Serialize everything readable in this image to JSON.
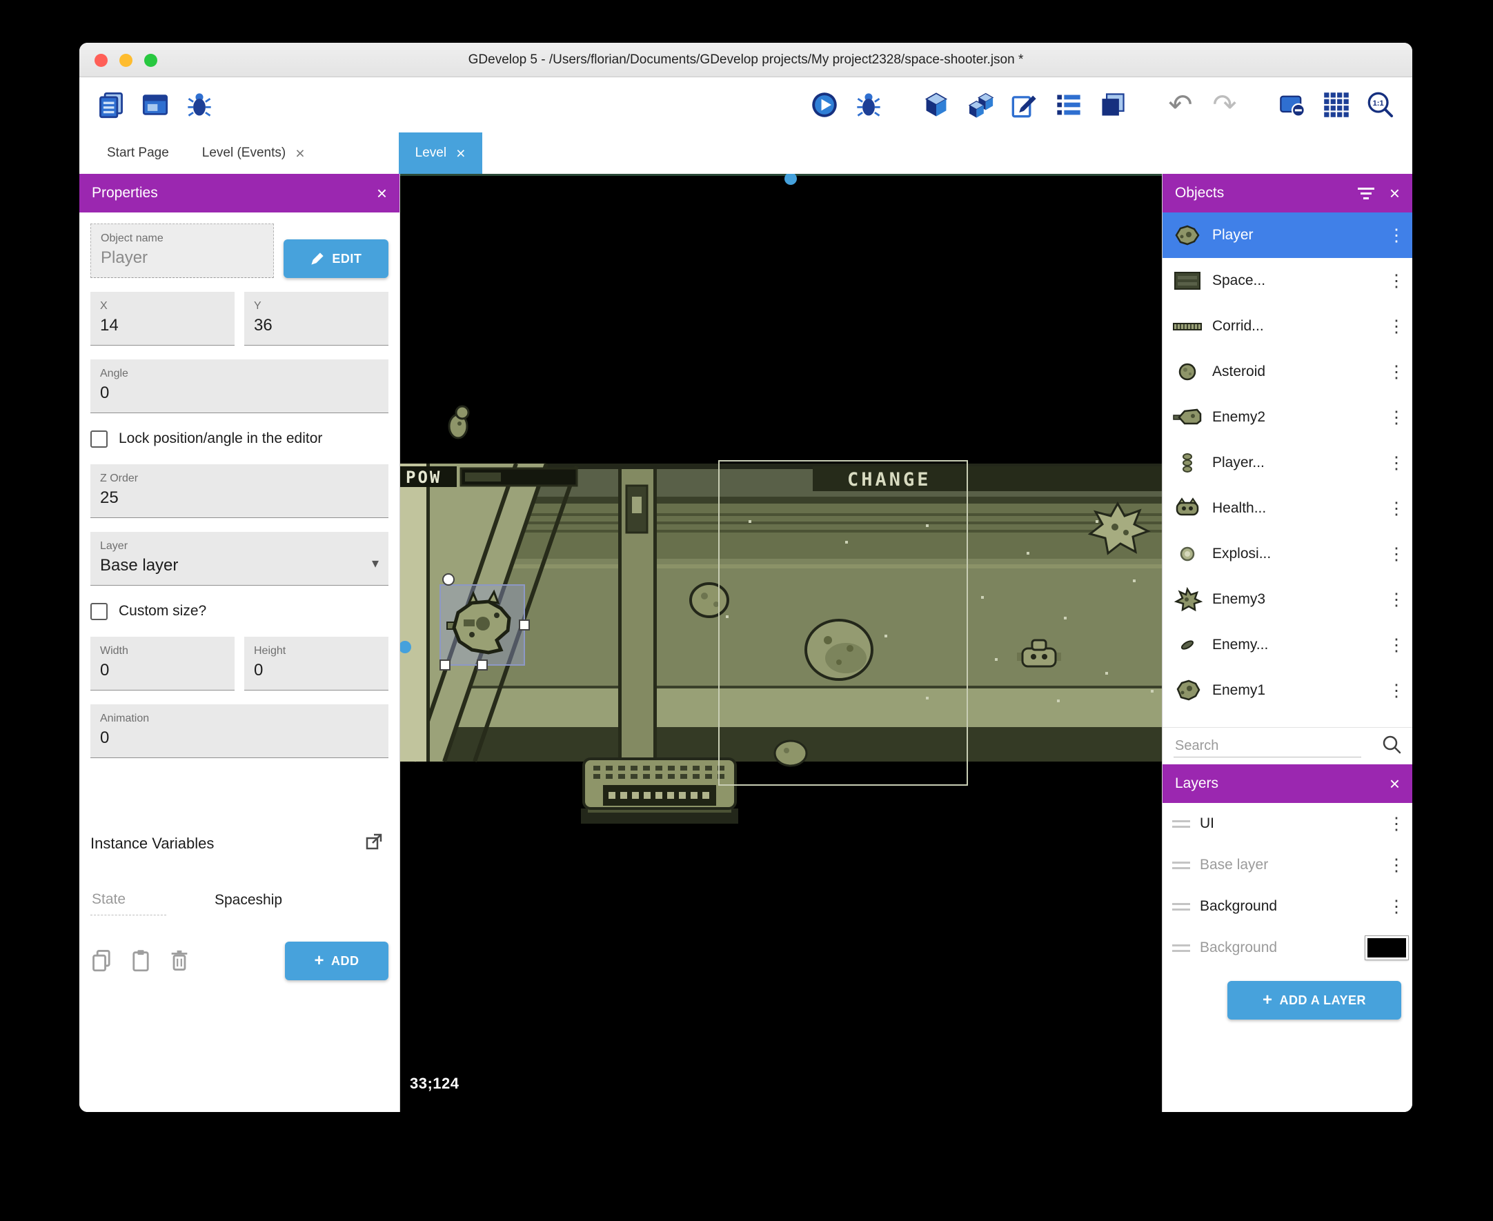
{
  "window": {
    "title": "GDevelop 5 - /Users/florian/Documents/GDevelop projects/My project2328/space-shooter.json *"
  },
  "icons": {
    "close": "×",
    "dots": "⋮",
    "undo": "↶",
    "redo": "↷",
    "dropdown": "▾",
    "plus": "+"
  },
  "tab_bar": {
    "tabs": [
      {
        "label": "Start Page"
      },
      {
        "label": "Level (Events)"
      },
      {
        "label": "Level"
      }
    ]
  },
  "properties_panel": {
    "title": "Properties",
    "object_name": {
      "label": "Object name",
      "value": "Player"
    },
    "edit_button": {
      "label": "EDIT"
    },
    "x_field": {
      "label": "X",
      "value": "14"
    },
    "y_field": {
      "label": "Y",
      "value": "36"
    },
    "angle_field": {
      "label": "Angle",
      "value": "0"
    },
    "lock_checkbox": {
      "label": "Lock position/angle in the editor",
      "checked": false
    },
    "z_order_field": {
      "label": "Z Order",
      "value": "25"
    },
    "layer_field": {
      "label": "Layer",
      "value": "Base layer"
    },
    "custom_size_checkbox": {
      "label": "Custom size?",
      "checked": false
    },
    "width_field": {
      "label": "Width",
      "value": "0"
    },
    "height_field": {
      "label": "Height",
      "value": "0"
    },
    "animation_field": {
      "label": "Animation",
      "value": "0"
    },
    "instance_variables_label": "Instance Variables",
    "tabs": {
      "state": "State",
      "spaceship": "Spaceship"
    },
    "add_button": {
      "label": "ADD"
    }
  },
  "canvas": {
    "coordinates": "33;124",
    "hud": {
      "pow": "POW",
      "change": "CHANGE"
    }
  },
  "objects_panel": {
    "title": "Objects",
    "items": [
      {
        "label": "Player",
        "selected": true
      },
      {
        "label": "Space...",
        "selected": false
      },
      {
        "label": "Corrid...",
        "selected": false
      },
      {
        "label": "Asteroid",
        "selected": false
      },
      {
        "label": "Enemy2",
        "selected": false
      },
      {
        "label": "Player...",
        "selected": false
      },
      {
        "label": "Health...",
        "selected": false
      },
      {
        "label": "Explosi...",
        "selected": false
      },
      {
        "label": "Enemy3",
        "selected": false
      },
      {
        "label": "Enemy...",
        "selected": false
      },
      {
        "label": "Enemy1",
        "selected": false
      }
    ],
    "search": {
      "placeholder": "Search"
    }
  },
  "layers_panel": {
    "title": "Layers",
    "items": [
      {
        "label": "UI",
        "muted": false
      },
      {
        "label": "Base layer",
        "muted": true
      },
      {
        "label": "Background",
        "muted": false
      },
      {
        "label": "Background",
        "muted": true,
        "swatch": "#000000"
      }
    ],
    "add_layer_button": {
      "label": "ADD A LAYER"
    }
  },
  "colors": {
    "accent_purple": "#9b27b0",
    "accent_blue": "#47a2dc",
    "selection_blue": "#4080e8",
    "scene_olive": "#6b734f"
  }
}
